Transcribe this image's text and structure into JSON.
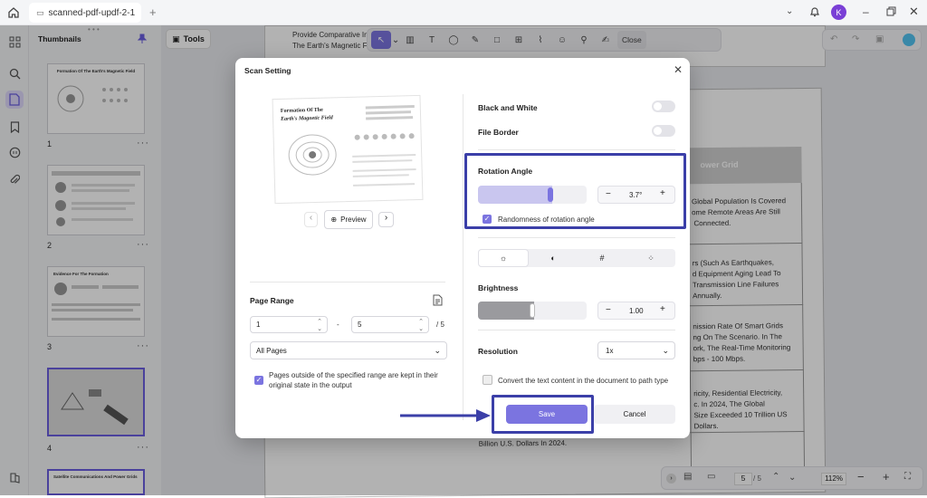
{
  "app": {
    "tab_title": "scanned-pdf-updf-2-1",
    "user_initial": "K"
  },
  "thumbnails": {
    "title": "Thumbnails",
    "pages": [
      {
        "num": "1",
        "heading": "Formation Of The Earth's Magnetic Field"
      },
      {
        "num": "2",
        "heading": ""
      },
      {
        "num": "3",
        "heading": "Evidence For The Formation"
      },
      {
        "num": "4",
        "heading": ""
      },
      {
        "num": "",
        "heading": "Satellite Communications And Power Grids"
      }
    ]
  },
  "tools_label": "Tools",
  "toolbar": {
    "close_label": "Close"
  },
  "document": {
    "lines_top": [
      "Provide Comparative Insight",
      "The Earth's Magnetic Field"
    ],
    "header": "ower Grid",
    "cells": [
      "Global Population Is Covered\nome Remote Areas Are Still\n Connected.",
      "rs (Such As Earthquakes,\nd Equipment Aging Lead To\nTransmission Line Failures\nAnnually.",
      "nission Rate Of Smart Grids\nng On The Scenario. In The\nork, The Real-Time Monitoring\nbps - 100 Mbps.",
      "ricity, Residential Electricity,\nc. In 2024, The Global\nSize Exceeded 10 Trillion US\nDollars."
    ],
    "bottom_text": "Billion U.S. Dollars In 2024."
  },
  "dialog": {
    "title": "Scan Setting",
    "preview": {
      "title_line1": "Formation Of The",
      "title_line2": "Earth's Magnetic Field",
      "button": "Preview"
    },
    "page_range": {
      "label": "Page Range",
      "from": "1",
      "to": "5",
      "total": "/ 5",
      "select": "All Pages",
      "keep_note": "Pages outside of the specified range are kept in their original state in the output"
    },
    "black_white": "Black and White",
    "file_border": "File Border",
    "rotation": {
      "label": "Rotation Angle",
      "value": "3.7°",
      "random_label": "Randomness of rotation angle"
    },
    "brightness": {
      "label": "Brightness",
      "value": "1.00"
    },
    "resolution": {
      "label": "Resolution",
      "value": "1x"
    },
    "convert_text": "Convert the text content in the document to path type",
    "save": "Save",
    "cancel": "Cancel"
  },
  "statusbar": {
    "page_current": "5",
    "page_total": "/ 5",
    "zoom": "112%"
  },
  "colors": {
    "accent": "#7b74e0",
    "highlight": "#3b3fa8",
    "arrow": "#3b3fa8"
  }
}
